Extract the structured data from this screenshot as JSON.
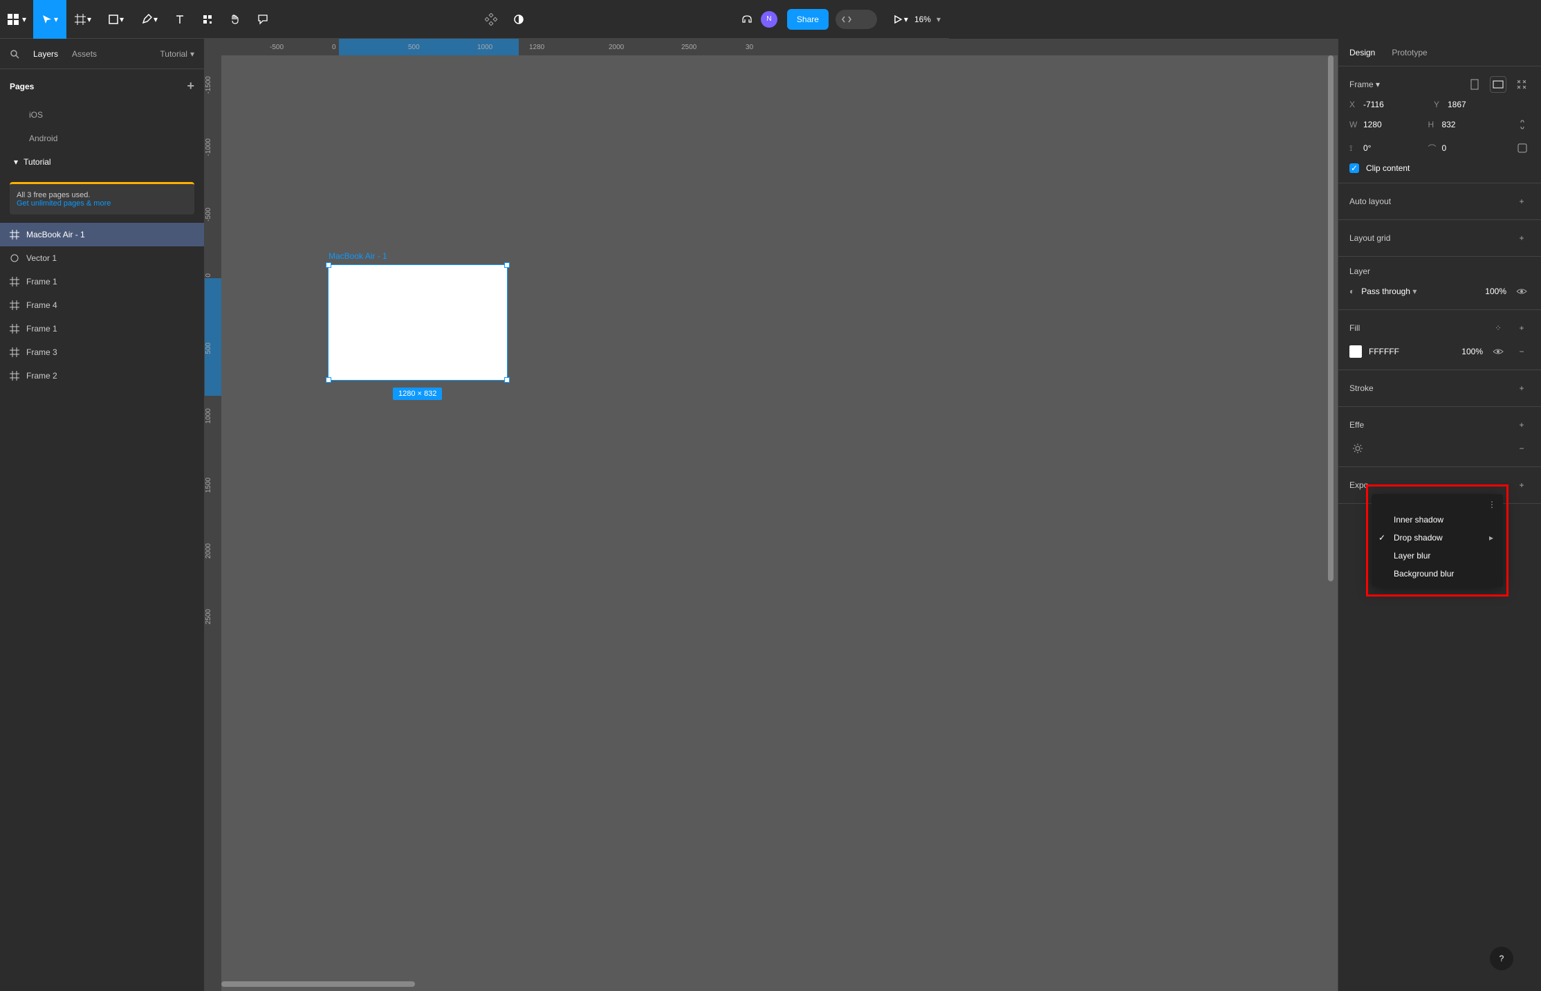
{
  "topbar": {
    "share_label": "Share",
    "zoom": "16%",
    "avatar_initial": "N"
  },
  "left": {
    "tabs": {
      "layers": "Layers",
      "assets": "Assets"
    },
    "file_name": "Tutorial",
    "pages_label": "Pages",
    "pages": [
      "iOS",
      "Android",
      "Tutorial"
    ],
    "upgrade_line1": "All 3 free pages used.",
    "upgrade_line2": "Get unlimited pages & more",
    "layers": [
      {
        "name": "MacBook Air - 1",
        "icon": "frame",
        "sel": true
      },
      {
        "name": "Vector 1",
        "icon": "vector"
      },
      {
        "name": "Frame 1",
        "icon": "frame"
      },
      {
        "name": "Frame 4",
        "icon": "frame"
      },
      {
        "name": "Frame 1",
        "icon": "frame"
      },
      {
        "name": "Frame 3",
        "icon": "frame"
      },
      {
        "name": "Frame 2",
        "icon": "frame"
      }
    ]
  },
  "canvas": {
    "ruler_h": [
      "-500",
      "0",
      "500",
      "1000",
      "1280",
      "2000",
      "2500",
      "30"
    ],
    "ruler_h_pos": [
      70,
      160,
      270,
      370,
      445,
      560,
      665,
      758
    ],
    "ruler_h_sel": {
      "start": 170,
      "end": 430
    },
    "ruler_v": [
      "-1500",
      "-1000",
      "-500",
      "0",
      "500",
      "1000",
      "1500",
      "2000",
      "2500"
    ],
    "ruler_v_pos": [
      30,
      120,
      220,
      315,
      415,
      510,
      610,
      705,
      800
    ],
    "ruler_v_sel": {
      "start": 322,
      "end": 492
    },
    "frame_label": "MacBook Air - 1",
    "frame_dim": "1280 × 832"
  },
  "right": {
    "tabs": {
      "design": "Design",
      "prototype": "Prototype"
    },
    "frame_label": "Frame",
    "x": "-7116",
    "y": "1867",
    "w": "1280",
    "h": "832",
    "rot": "0°",
    "rad": "0",
    "clip_label": "Clip content",
    "auto_layout": "Auto layout",
    "layout_grid": "Layout grid",
    "layer_label": "Layer",
    "blend": "Pass through",
    "blend_opacity": "100%",
    "fill_label": "Fill",
    "fill_hex": "FFFFFF",
    "fill_opacity": "100%",
    "stroke_label": "Stroke",
    "effects_label": "Effe",
    "export_label": "Expo"
  },
  "fx_menu": {
    "items": [
      "Inner shadow",
      "Drop shadow",
      "Layer blur",
      "Background blur"
    ],
    "selected": 1
  }
}
